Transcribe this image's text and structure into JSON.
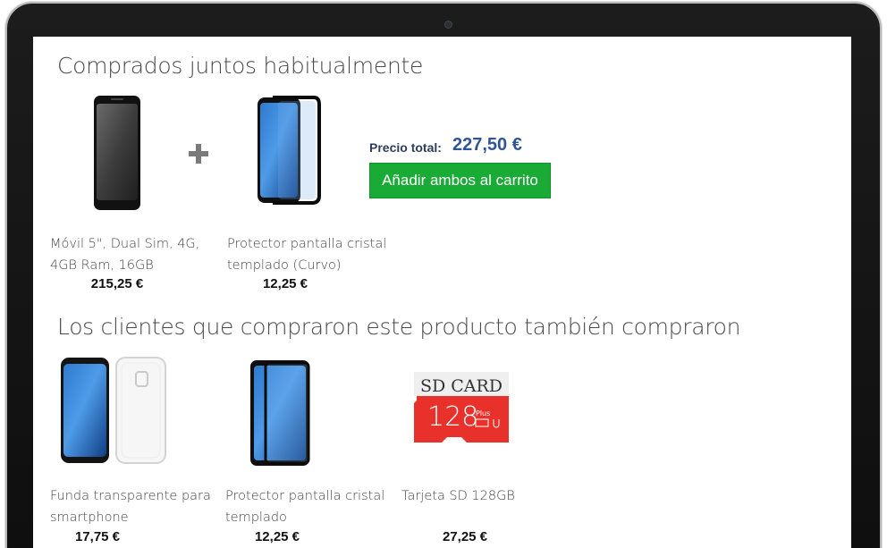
{
  "bought_together": {
    "title": "Comprados juntos habitualmente",
    "items": [
      {
        "name": "Móvil 5\", Dual Sim, 4G, 4GB Ram, 16GB",
        "price": "215,25 €",
        "icon": "smartphone-image"
      },
      {
        "name": "Protector  pantalla cristal templado (Curvo)",
        "price": "12,25 €",
        "icon": "screen-protector-curved-image"
      }
    ],
    "total_label": "Precio total:",
    "total_value": "227,50 €",
    "add_button_label": "Añadir ambos al carrito"
  },
  "also_bought": {
    "title": "Los clientes que compraron este producto también compraron",
    "items": [
      {
        "name": "Funda transparente para smartphone",
        "price": "17,75 €",
        "icon": "clear-case-image"
      },
      {
        "name": "Protector pantalla cristal templado",
        "price": "12,25 €",
        "icon": "screen-protector-image"
      },
      {
        "name": "Tarjeta SD 128GB",
        "price": "27,25 €",
        "icon": "sd-card-image"
      }
    ],
    "sd_card_label": "SD CARD",
    "sd_card_capacity": "128",
    "sd_card_plus": "Plus"
  },
  "colors": {
    "button_green": "#1aab36",
    "total_blue": "#2f5597",
    "sd_red": "#e8312a"
  }
}
